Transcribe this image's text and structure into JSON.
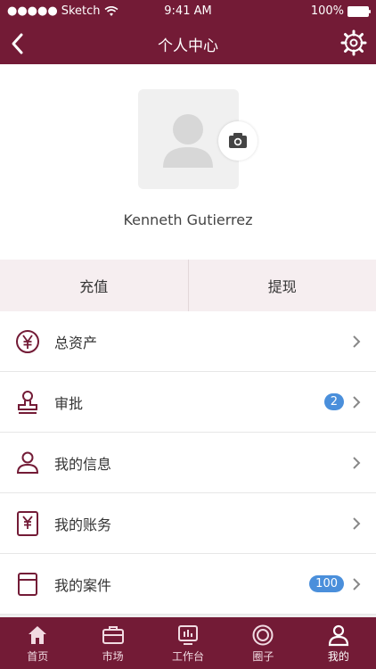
{
  "status": {
    "carrier": "Sketch",
    "time": "9:41 AM",
    "battery": "100%"
  },
  "nav": {
    "title": "个人中心"
  },
  "profile": {
    "name": "Kenneth Gutierrez"
  },
  "actions": {
    "left": "充值",
    "right": "提现"
  },
  "list": [
    {
      "label": "总资产",
      "badge": null,
      "icon": "yen-circle-icon"
    },
    {
      "label": "审批",
      "badge": "2",
      "icon": "stamp-icon"
    },
    {
      "label": "我的信息",
      "badge": null,
      "icon": "user-icon"
    },
    {
      "label": "我的账务",
      "badge": null,
      "icon": "ledger-icon"
    },
    {
      "label": "我的案件",
      "badge": "100",
      "icon": "case-icon"
    }
  ],
  "tabs": [
    {
      "label": "首页",
      "icon": "home-icon"
    },
    {
      "label": "市场",
      "icon": "briefcase-icon"
    },
    {
      "label": "工作台",
      "icon": "dashboard-icon"
    },
    {
      "label": "圈子",
      "icon": "circle-icon"
    },
    {
      "label": "我的",
      "icon": "profile-icon"
    }
  ],
  "colors": {
    "primary": "#731b36",
    "badge": "#4a8fdb"
  }
}
